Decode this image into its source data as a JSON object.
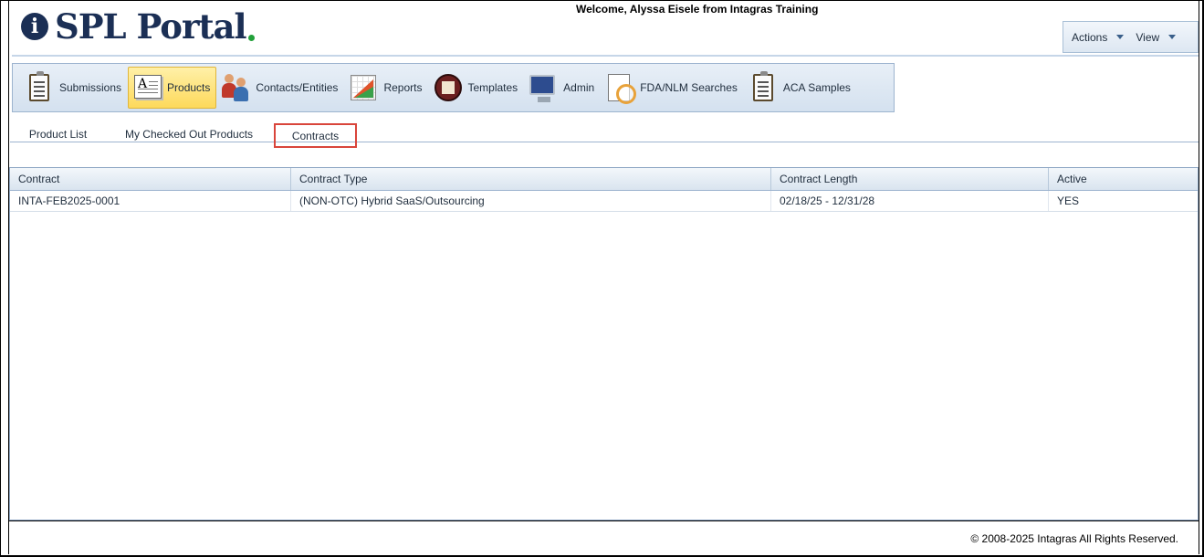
{
  "app": {
    "logo_letter": "i",
    "logo_text": "SPL Portal",
    "welcome": "Welcome, Alyssa Eisele from Intagras Training",
    "brand_color": "#1b2f55",
    "accent_dot_color": "#22a13a"
  },
  "topright": {
    "actions_label": "Actions",
    "view_label": "View"
  },
  "toolbar": {
    "items": [
      {
        "label": "Submissions",
        "icon": "clipboard-icon"
      },
      {
        "label": "Products",
        "icon": "document-icon",
        "active": true
      },
      {
        "label": "Contacts/Entities",
        "icon": "people-icon"
      },
      {
        "label": "Reports",
        "icon": "chart-icon"
      },
      {
        "label": "Templates",
        "icon": "templates-icon"
      },
      {
        "label": "Admin",
        "icon": "monitor-icon"
      },
      {
        "label": "FDA/NLM Searches",
        "icon": "search-document-icon"
      },
      {
        "label": "ACA Samples",
        "icon": "clipboard-icon"
      }
    ]
  },
  "subtabs": {
    "items": [
      {
        "label": "Product List"
      },
      {
        "label": "My Checked Out Products"
      },
      {
        "label": "Contracts",
        "selected": true
      }
    ]
  },
  "grid": {
    "columns": [
      "Contract",
      "Contract Type",
      "Contract Length",
      "Active"
    ],
    "rows": [
      [
        "INTA-FEB2025-0001",
        "(NON-OTC) Hybrid SaaS/Outsourcing",
        "02/18/25 - 12/31/28",
        "YES"
      ]
    ]
  },
  "footer": {
    "copyright": "© 2008-2025 Intagras All Rights Reserved."
  }
}
